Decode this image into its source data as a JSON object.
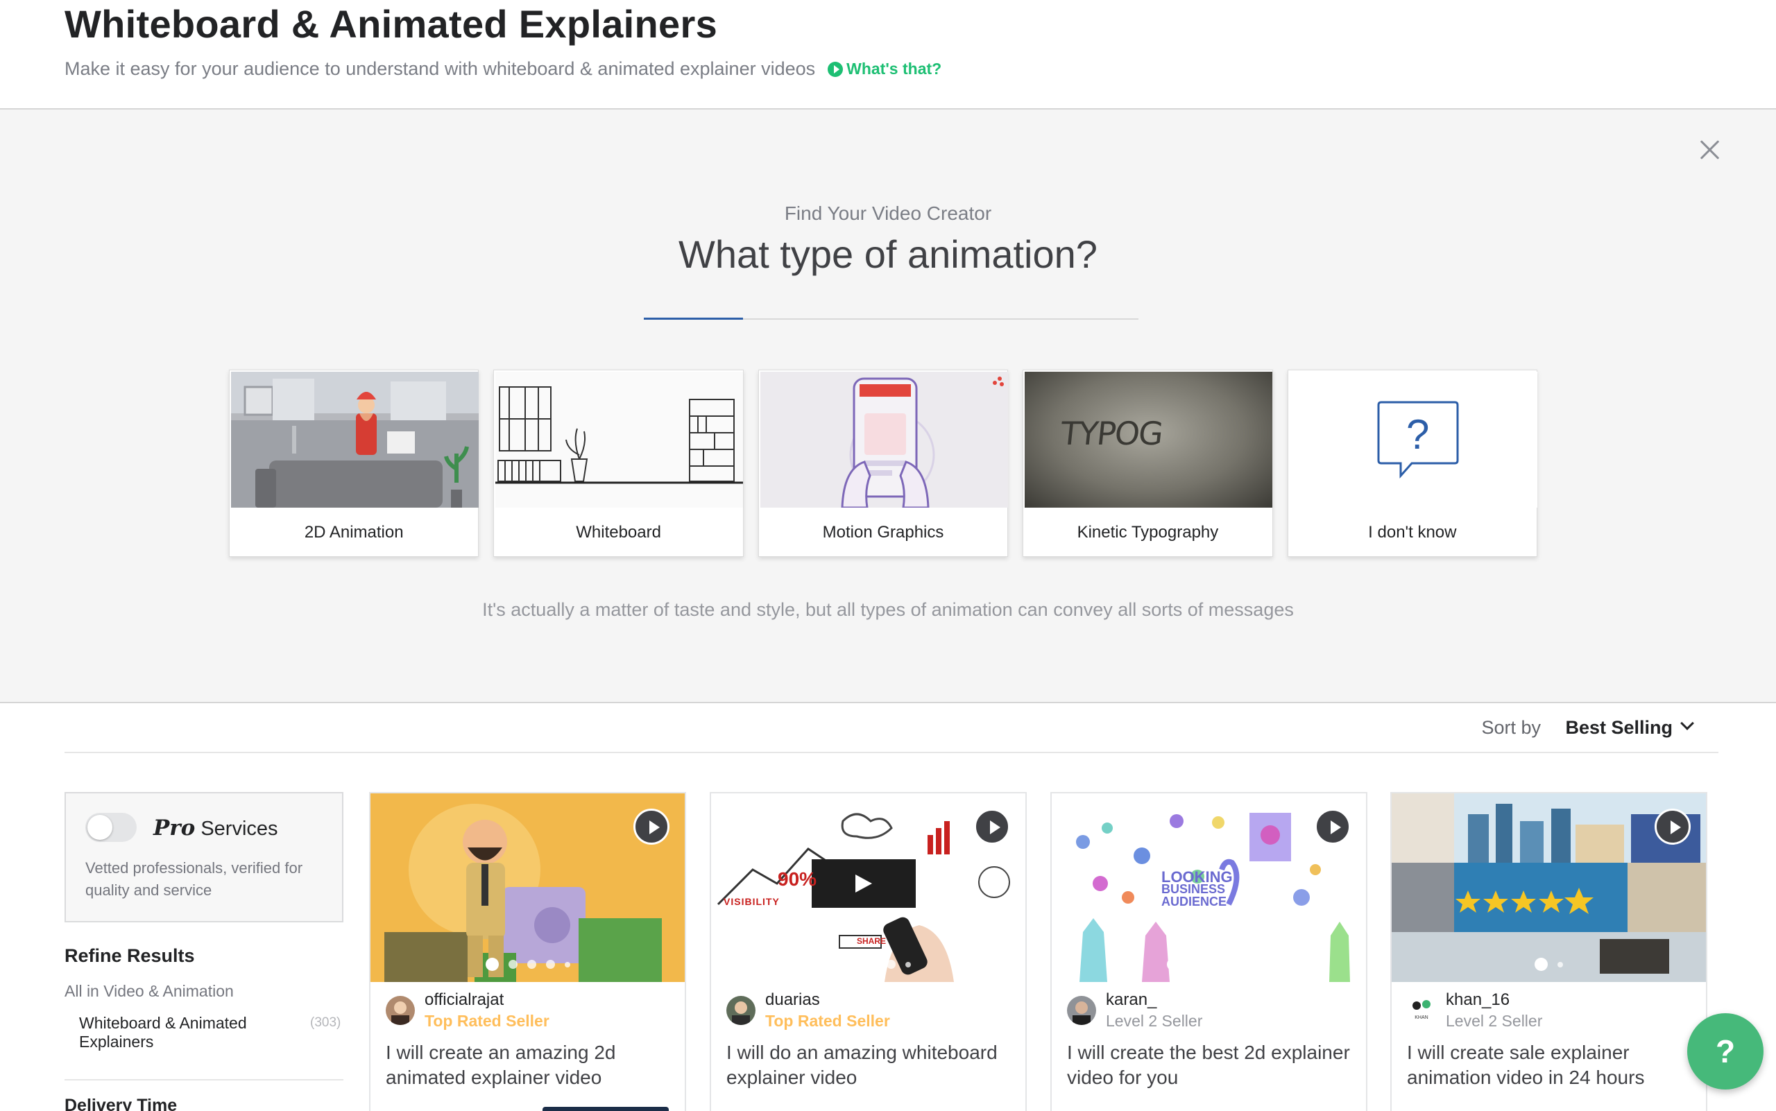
{
  "header": {
    "title": "Whiteboard & Animated Explainers",
    "subtitle": "Make it easy for your audience to understand with whiteboard & animated explainer videos",
    "whats_that": "What's that?"
  },
  "wizard": {
    "kicker": "Find Your Video Creator",
    "question": "What type of animation?",
    "options": [
      {
        "label": "2D Animation"
      },
      {
        "label": "Whiteboard"
      },
      {
        "label": "Motion Graphics"
      },
      {
        "label": "Kinetic Typography",
        "thumb_text": "TYPOG"
      },
      {
        "label": "I don't know",
        "icon_text": "?"
      }
    ],
    "note": "It's actually a matter of taste and style, but all types of animation can convey all sorts of messages",
    "progress": 0.2
  },
  "sort": {
    "label": "Sort by",
    "value": "Best Selling"
  },
  "sidebar": {
    "pro": {
      "mark": "Pro",
      "title": "Services",
      "description": "Vetted professionals, verified for quality and service",
      "enabled": false
    },
    "refine_title": "Refine Results",
    "all_category": "All in Video & Animation",
    "category": "Whiteboard & Animated Explainers",
    "category_count": "(303)",
    "delivery_title": "Delivery Time"
  },
  "gigs": [
    {
      "seller": "officialrajat",
      "level": "Top Rated Seller",
      "title": "I will create an amazing 2d animated explainer video",
      "thumb_texts": []
    },
    {
      "seller": "duarias",
      "level": "Top Rated Seller",
      "title": "I will do an amazing whiteboard explainer video",
      "thumb_texts": [
        "90%",
        "VISIBILITY",
        "SHARE"
      ]
    },
    {
      "seller": "karan_",
      "level": "Level 2 Seller",
      "title": "I will create the best 2d explainer video for you",
      "thumb_texts": [
        "LOOKING",
        "BUSINESS",
        "AUDIENCE"
      ]
    },
    {
      "seller": "khan_16",
      "level": "Level 2 Seller",
      "title": "I will create sale explainer animation video in 24 hours",
      "thumb_texts": [
        "KHAN"
      ]
    }
  ],
  "help": "?",
  "colors": {
    "brand_green": "#1dbf73",
    "top_rated": "#ffbe5b",
    "fab": "#46b97a"
  }
}
